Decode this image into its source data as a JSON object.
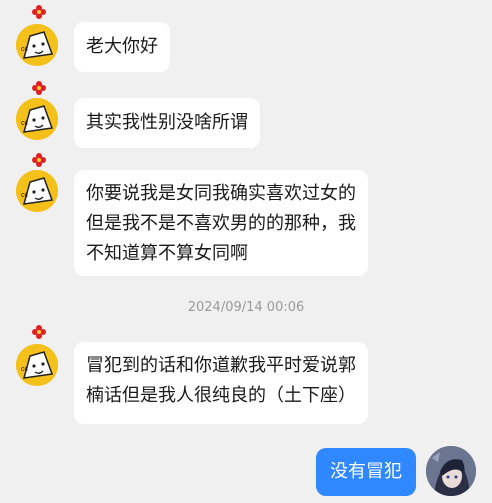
{
  "messages": [
    {
      "side": "incoming",
      "lines": [
        "老大你好"
      ]
    },
    {
      "side": "incoming",
      "lines": [
        "其实我性别没啥所谓"
      ]
    },
    {
      "side": "incoming",
      "lines": [
        "你要说我是女同我确实喜欢过女的",
        "但是我不是不喜欢男的的那种，我",
        "不知道算不算女同啊"
      ]
    },
    {
      "side": "incoming",
      "lines": [
        "冒犯到的话和你道歉我平时爱说郭",
        "楠话但是我人很纯良的（土下座）"
      ]
    }
  ],
  "timestamp": "2024/09/14 00:06",
  "outgoing": {
    "text": "没有冒犯"
  },
  "icons": {
    "contact_avatar": "cartoon-face-avatar",
    "flower": "red-flower-icon",
    "self_avatar": "anime-character-avatar"
  },
  "colors": {
    "background": "#f0f0f0",
    "incoming_bubble": "#ffffff",
    "outgoing_bubble": "#2f88ff",
    "timestamp": "#9a9a9a"
  }
}
